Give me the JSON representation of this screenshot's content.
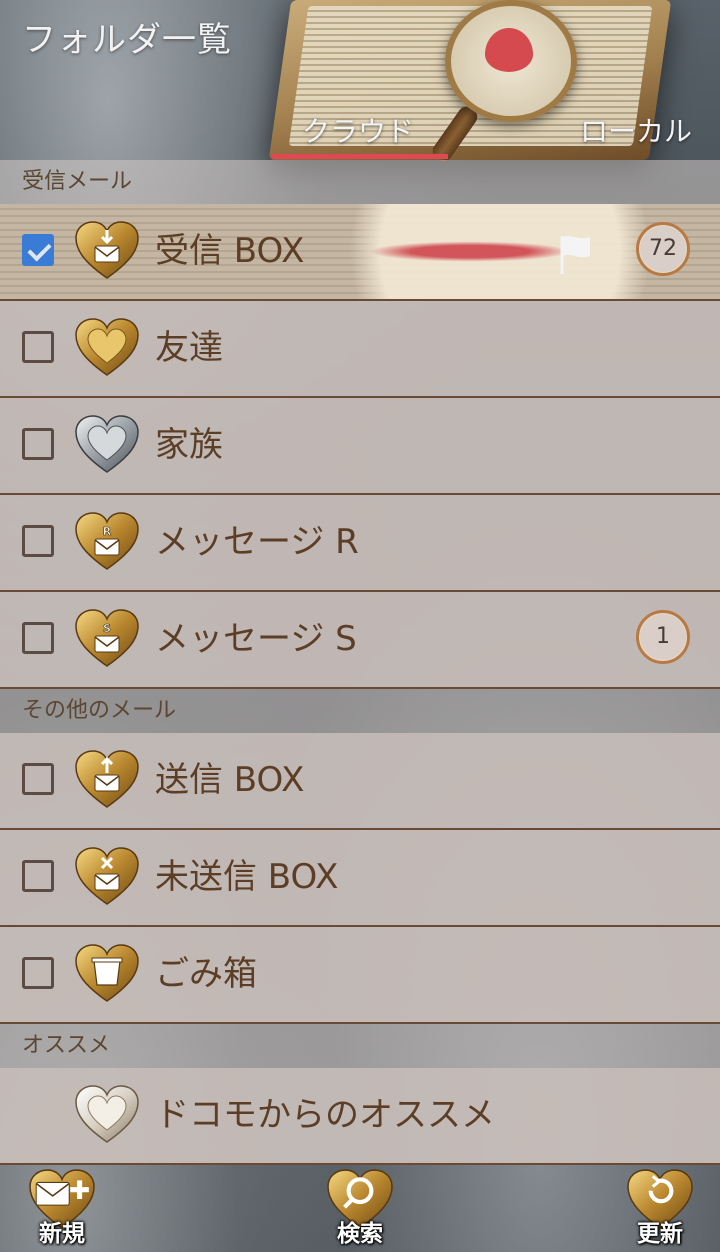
{
  "header": {
    "title": "フォルダ一覧",
    "tabs": [
      {
        "label": "クラウド",
        "active": true
      },
      {
        "label": "ローカル",
        "active": false
      }
    ]
  },
  "sections": [
    {
      "label": "受信メール"
    },
    {
      "label": "その他のメール"
    },
    {
      "label": "オススメ"
    }
  ],
  "folders": [
    {
      "label": "受信 BOX",
      "checked": true,
      "icon": "heart-inbox-icon",
      "badge": "72",
      "flag": true
    },
    {
      "label": "友達",
      "checked": false,
      "icon": "heart-gold-icon"
    },
    {
      "label": "家族",
      "checked": false,
      "icon": "heart-silver-icon"
    },
    {
      "label": "メッセージ R",
      "checked": false,
      "icon": "heart-message-r-icon"
    },
    {
      "label": "メッセージ S",
      "checked": false,
      "icon": "heart-message-s-icon",
      "badge": "1"
    },
    {
      "label": "送信 BOX",
      "checked": false,
      "icon": "heart-outbox-icon"
    },
    {
      "label": "未送信 BOX",
      "checked": false,
      "icon": "heart-unsent-icon"
    },
    {
      "label": "ごみ箱",
      "checked": false,
      "icon": "heart-trash-icon"
    },
    {
      "label": "ドコモからのオススメ",
      "icon": "heart-white-icon"
    }
  ],
  "toolbar": {
    "new_label": "新規",
    "search_label": "検索",
    "update_label": "更新"
  },
  "colors": {
    "accent_tab_underline": "#e04954",
    "checkbox_checked": "#3a7bd5",
    "row_text": "#5c3e26",
    "row_background": "#c8beba",
    "divider": "#6a4a32"
  }
}
